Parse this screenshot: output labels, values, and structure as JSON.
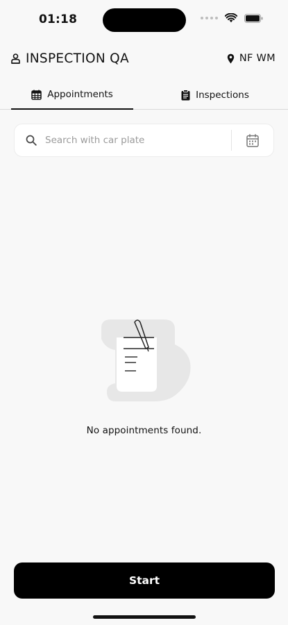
{
  "status_bar": {
    "time": "01:18",
    "icons": [
      "signal-dots-icon",
      "wifi-icon",
      "battery-icon"
    ]
  },
  "header": {
    "title": "INSPECTION QA",
    "title_icon": "user-badge-icon",
    "location": "NF WM",
    "location_icon": "location-pin-icon"
  },
  "tabs": [
    {
      "label": "Appointments",
      "icon": "calendar-grid-icon",
      "active": true
    },
    {
      "label": "Inspections",
      "icon": "clipboard-icon",
      "active": false
    }
  ],
  "search": {
    "placeholder": "Search with car plate",
    "value": "",
    "icon": "search-icon",
    "filter_icon": "calendar-icon"
  },
  "empty_state": {
    "message": "No appointments found.",
    "illustration": "document-pen-illustration"
  },
  "actions": {
    "start_label": "Start"
  },
  "colors": {
    "background": "#f8f8f8",
    "primary": "#000000",
    "text": "#111111",
    "placeholder": "#9a9a9a",
    "divider": "#d9d9d9"
  }
}
